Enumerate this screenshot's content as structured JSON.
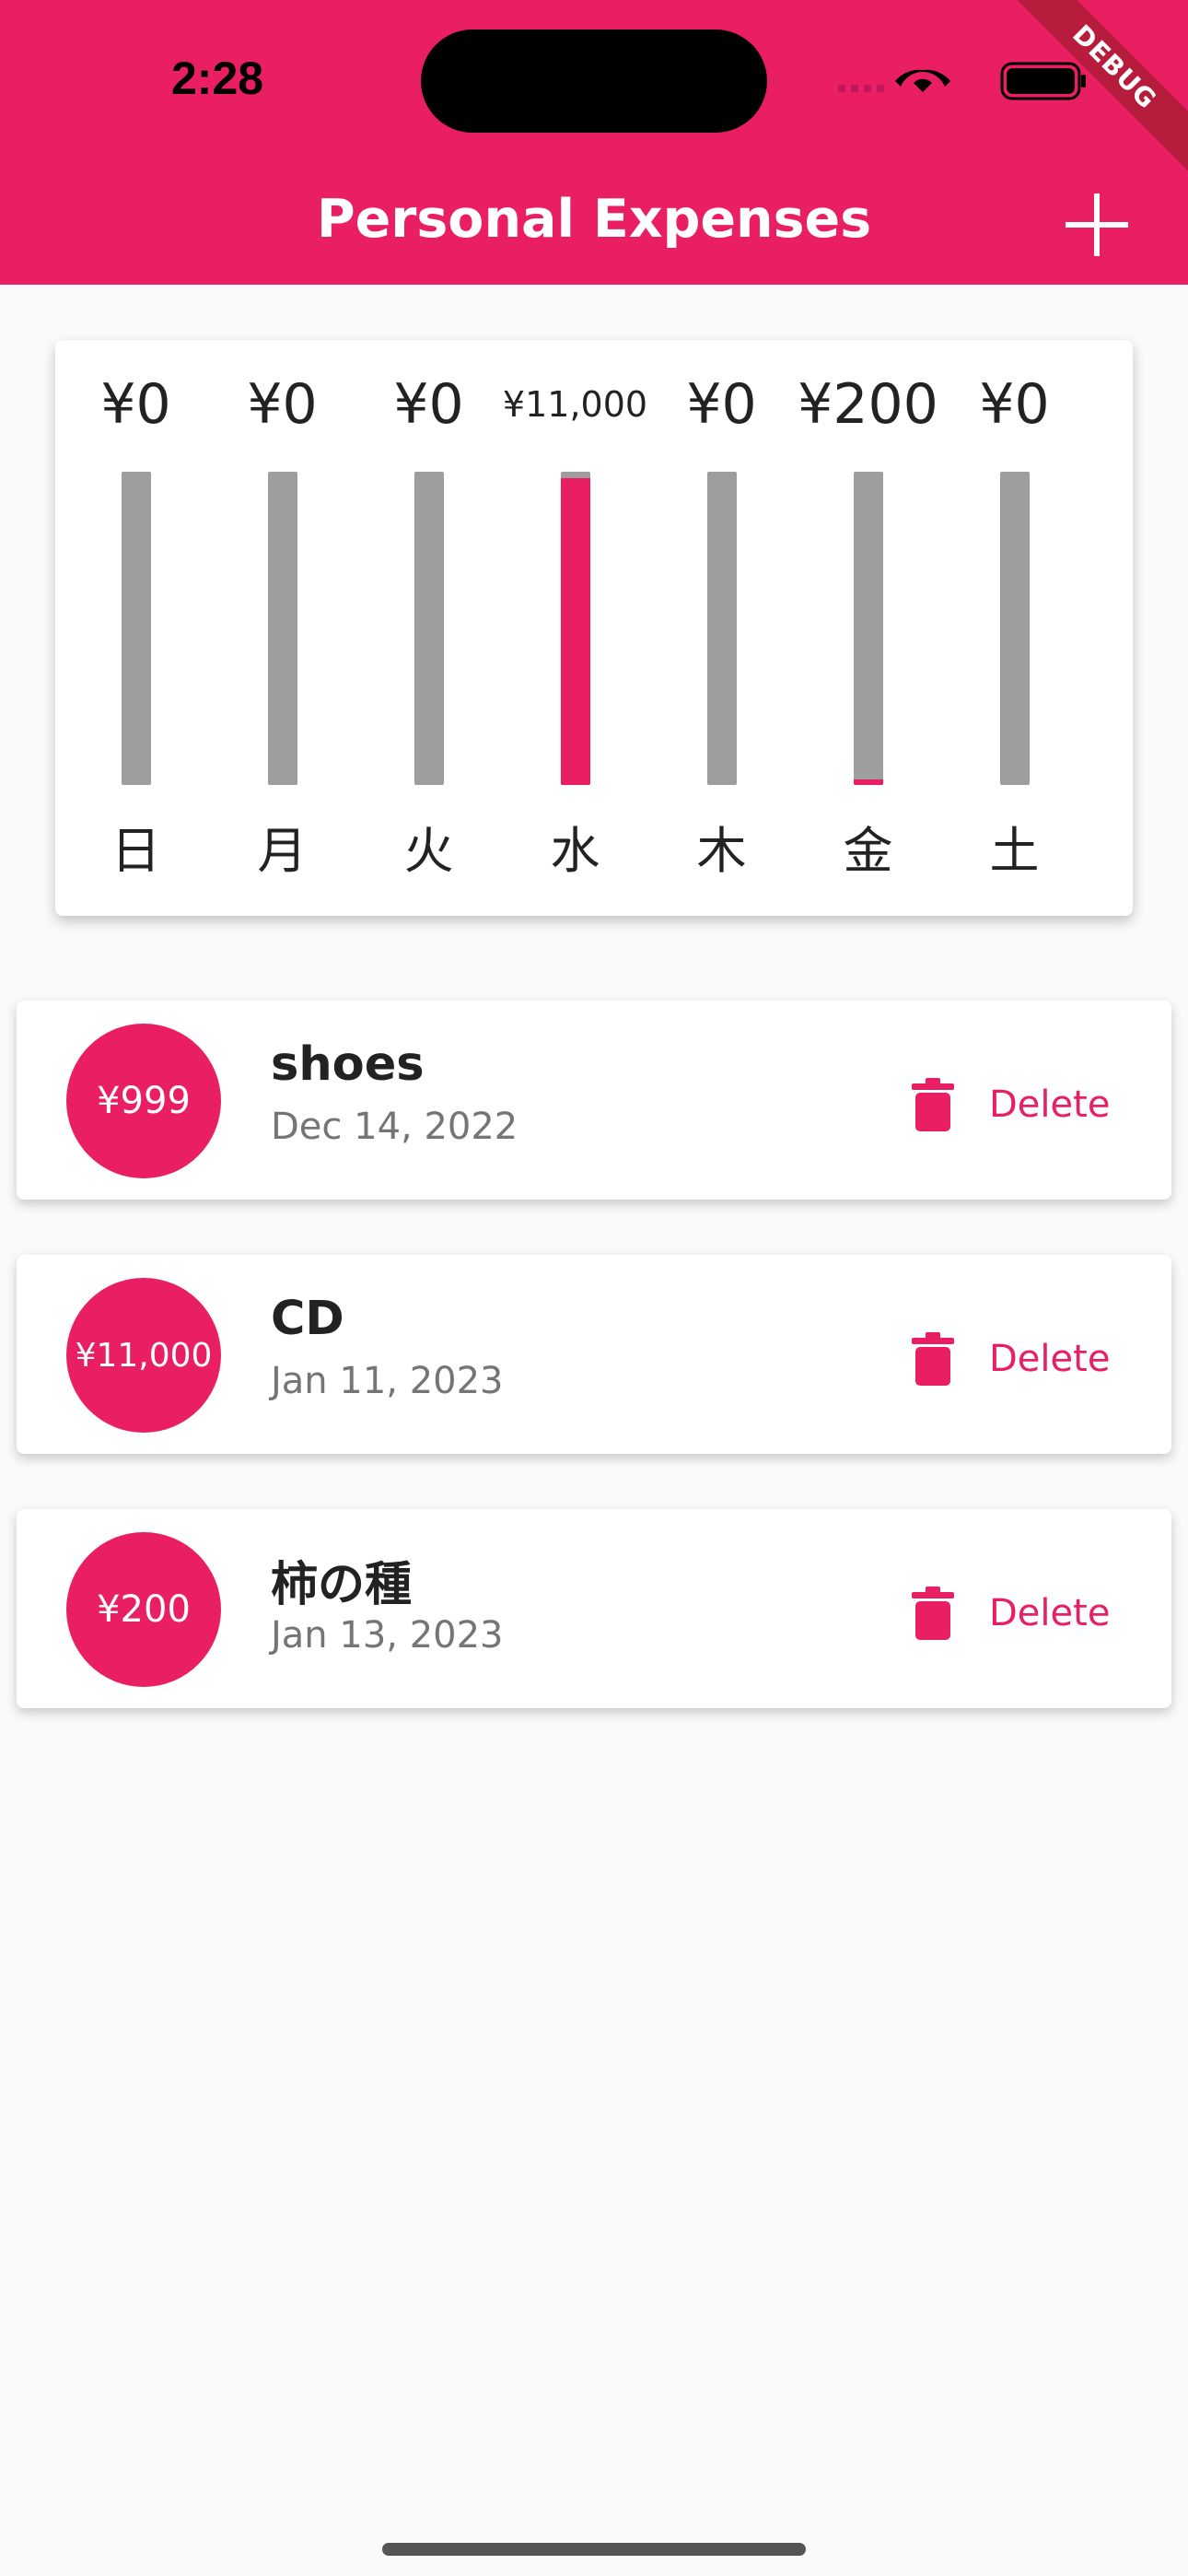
{
  "status_bar": {
    "time": "2:28"
  },
  "debug_banner": "DEBUG",
  "app_bar": {
    "title": "Personal Expenses",
    "add_icon": "plus-icon"
  },
  "colors": {
    "primary": "#e91e63",
    "bar_track": "#9e9e9e",
    "background": "#fafafa"
  },
  "chart_data": {
    "type": "bar",
    "categories": [
      "日",
      "月",
      "火",
      "水",
      "木",
      "金",
      "土"
    ],
    "labels": [
      "¥0",
      "¥0",
      "¥0",
      "¥11,000",
      "¥0",
      "¥200",
      "¥0"
    ],
    "values": [
      0,
      0,
      0,
      11000,
      0,
      200,
      0
    ],
    "fill_fraction": [
      0,
      0,
      0,
      0.98,
      0,
      0.018,
      0
    ]
  },
  "transactions": [
    {
      "amount": "¥999",
      "title": "shoes",
      "date": "Dec 14, 2022",
      "delete_label": "Delete"
    },
    {
      "amount": "¥11,000",
      "title": "CD",
      "date": "Jan 11, 2023",
      "delete_label": "Delete"
    },
    {
      "amount": "¥200",
      "title": "柿の種",
      "date": "Jan 13, 2023",
      "delete_label": "Delete"
    }
  ]
}
